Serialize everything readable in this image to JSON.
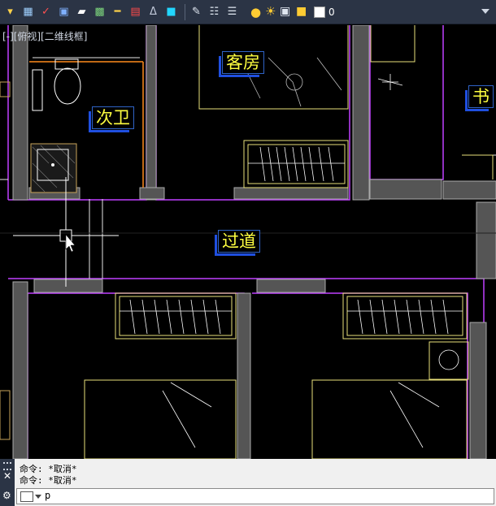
{
  "toolbar": {
    "layer_value": "0",
    "colors": {
      "background": "#2b3445"
    }
  },
  "viewport": {
    "label": "[-][俯视][二维线框]"
  },
  "rooms": {
    "guest_room": "客房",
    "second_bath": "次卫",
    "study": "书",
    "corridor": "过道",
    "bottom_left": "",
    "bottom_right": ""
  },
  "command": {
    "history": [
      "命令:  *取消*",
      "命令:  *取消*"
    ],
    "input_value": "p"
  }
}
